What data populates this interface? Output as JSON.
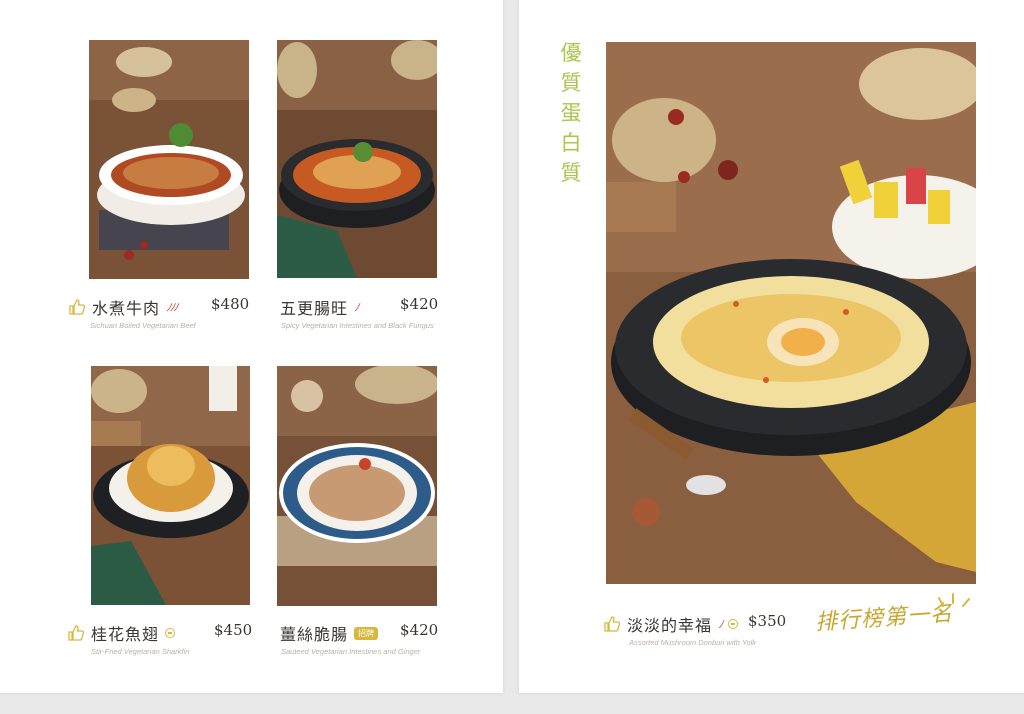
{
  "left_page": {
    "items": [
      {
        "name": "水煮牛肉",
        "price": "$480",
        "subtitle": "Sichuan Boiled Vegetarian Beef",
        "spice": "ﾉﾉﾉ"
      },
      {
        "name": "五更腸旺",
        "price": "$420",
        "subtitle": "Spicy Vegetarian Intestines and Black Fungus",
        "spice": "ﾉ"
      },
      {
        "name": "桂花魚翅",
        "price": "$450",
        "subtitle": "Stir-Fried Vegetarian Sharkfin"
      },
      {
        "name": "薑絲脆腸",
        "price": "$420",
        "subtitle": "Sauteed Vegetarian Intestines and Ginger",
        "badge": "招牌"
      }
    ]
  },
  "right_page": {
    "vertical_title": "優質蛋白質",
    "item": {
      "name": "淡淡的幸福",
      "price": "$350",
      "subtitle": "Assorted Mushroom Donburi with Yolk",
      "spice": "ﾉ"
    },
    "slogan": "排行榜第一名"
  },
  "icons": {
    "recommend": "thumbs-up-icon",
    "veg": "vegetarian-icon",
    "spice": "chili-icon"
  },
  "colors": {
    "accent_green": "#a9c64e",
    "accent_gold": "#d9b73e",
    "chili_red": "#c84a2c"
  }
}
